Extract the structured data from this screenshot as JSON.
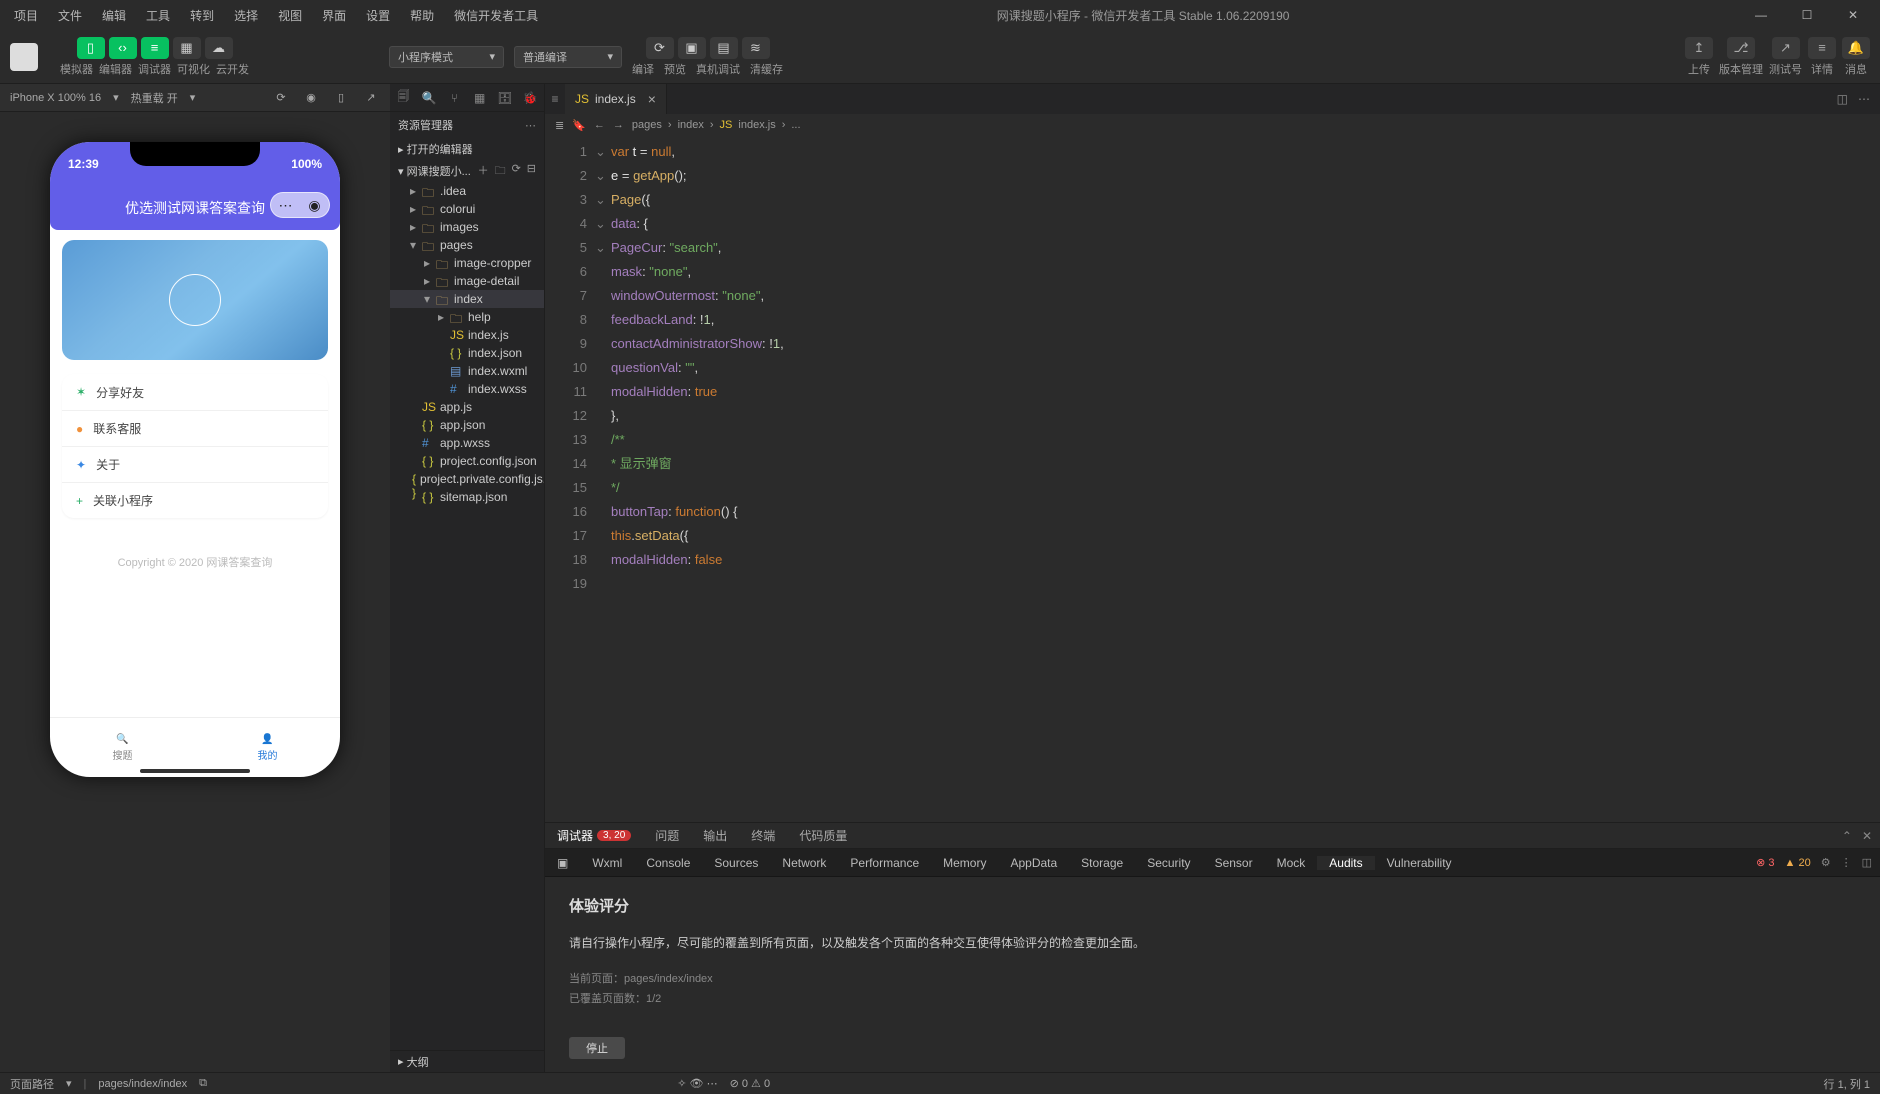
{
  "menubar": [
    "项目",
    "文件",
    "编辑",
    "工具",
    "转到",
    "选择",
    "视图",
    "界面",
    "设置",
    "帮助",
    "微信开发者工具"
  ],
  "window_title": "网课搜题小程序 - 微信开发者工具 Stable 1.06.2209190",
  "ribbon": {
    "groups": [
      {
        "btns": [
          "▭",
          "</>",
          "≡"
        ],
        "labels": "模拟器",
        "green": true
      },
      {
        "btns": [
          "≡"
        ],
        "labels": "编辑器",
        "green": true,
        "hidden": true
      }
    ],
    "g2": {
      "labels": [
        "模拟器",
        "编辑器",
        "调试器",
        "可视化",
        "云开发"
      ]
    },
    "mode": "小程序模式",
    "compile": "普通编译",
    "mid_labels": [
      "编译",
      "预览",
      "真机调试",
      "清缓存"
    ],
    "right_labels": [
      "上传",
      "版本管理",
      "测试号",
      "详情",
      "消息"
    ]
  },
  "sim": {
    "device": "iPhone X 100% 16",
    "hot": "热重载 开",
    "time": "12:39",
    "battery": "100%",
    "app_title": "优选测试网课答案查询",
    "menus": [
      {
        "icon": "✶",
        "color": "#2aae67",
        "label": "分享好友"
      },
      {
        "icon": "●",
        "color": "#f0913b",
        "label": "联系客服"
      },
      {
        "icon": "✦",
        "color": "#3a88e3",
        "label": "关于"
      },
      {
        "icon": "+",
        "color": "#2aae67",
        "label": "关联小程序"
      }
    ],
    "copyright": "Copyright © 2020 网课答案查询",
    "tabs": [
      {
        "icon": "🔍",
        "label": "搜题"
      },
      {
        "icon": "👤",
        "label": "我的"
      }
    ]
  },
  "explorer": {
    "title": "资源管理器",
    "open_editors": "打开的编辑器",
    "project": "网课搜题小...",
    "tree": [
      {
        "d": 1,
        "t": "folder",
        "n": ".idea",
        "c": false
      },
      {
        "d": 1,
        "t": "folder",
        "n": "colorui",
        "c": false
      },
      {
        "d": 1,
        "t": "folder",
        "n": "images",
        "c": false,
        "cls": "folder-img"
      },
      {
        "d": 1,
        "t": "folder",
        "n": "pages",
        "c": true,
        "cls": "folder-pg"
      },
      {
        "d": 2,
        "t": "folder",
        "n": "image-cropper",
        "c": false
      },
      {
        "d": 2,
        "t": "folder",
        "n": "image-detail",
        "c": false
      },
      {
        "d": 2,
        "t": "folder",
        "n": "index",
        "c": true,
        "sel": true
      },
      {
        "d": 3,
        "t": "folder",
        "n": "help",
        "c": false
      },
      {
        "d": 3,
        "t": "js",
        "n": "index.js"
      },
      {
        "d": 3,
        "t": "json",
        "n": "index.json"
      },
      {
        "d": 3,
        "t": "wxml",
        "n": "index.wxml"
      },
      {
        "d": 3,
        "t": "wxss",
        "n": "index.wxss"
      },
      {
        "d": 1,
        "t": "js",
        "n": "app.js"
      },
      {
        "d": 1,
        "t": "json",
        "n": "app.json"
      },
      {
        "d": 1,
        "t": "wxss",
        "n": "app.wxss"
      },
      {
        "d": 1,
        "t": "json",
        "n": "project.config.json"
      },
      {
        "d": 1,
        "t": "json",
        "n": "project.private.config.js..."
      },
      {
        "d": 1,
        "t": "json",
        "n": "sitemap.json"
      }
    ],
    "outline": "大纲"
  },
  "editor": {
    "tab": "index.js",
    "crumbs": [
      "pages",
      "index",
      "index.js",
      "..."
    ],
    "lines": [
      [
        [
          "kw",
          "var"
        ],
        [
          "id",
          " t "
        ],
        [
          "op",
          "="
        ],
        [
          "id",
          " "
        ],
        [
          "bool",
          "null"
        ],
        [
          "op",
          ","
        ]
      ],
      [
        [
          "id",
          "    e "
        ],
        [
          "op",
          "="
        ],
        [
          "id",
          " "
        ],
        [
          "fn",
          "getApp"
        ],
        [
          "op",
          "();"
        ]
      ],
      [
        [
          "fn",
          "Page"
        ],
        [
          "op",
          "({"
        ]
      ],
      [
        [
          "id",
          "  "
        ],
        [
          "prop",
          "data"
        ],
        [
          "op",
          ": {"
        ]
      ],
      [
        [
          "id",
          "    "
        ],
        [
          "prop",
          "PageCur"
        ],
        [
          "op",
          ": "
        ],
        [
          "strg",
          "\"search\""
        ],
        [
          "op",
          ","
        ]
      ],
      [
        [
          "id",
          "    "
        ],
        [
          "prop",
          "mask"
        ],
        [
          "op",
          ": "
        ],
        [
          "strg",
          "\"none\""
        ],
        [
          "op",
          ","
        ]
      ],
      [
        [
          "id",
          "    "
        ],
        [
          "prop",
          "windowOutermost"
        ],
        [
          "op",
          ": "
        ],
        [
          "strg",
          "\"none\""
        ],
        [
          "op",
          ","
        ]
      ],
      [
        [
          "id",
          "    "
        ],
        [
          "prop",
          "feedbackLand"
        ],
        [
          "op",
          ": !"
        ],
        [
          "num",
          "1"
        ],
        [
          "op",
          ","
        ]
      ],
      [
        [
          "id",
          "    "
        ],
        [
          "prop",
          "contactAdministratorShow"
        ],
        [
          "op",
          ": !"
        ],
        [
          "num",
          "1"
        ],
        [
          "op",
          ","
        ]
      ],
      [
        [
          "id",
          "    "
        ],
        [
          "prop",
          "questionVal"
        ],
        [
          "op",
          ": "
        ],
        [
          "strg",
          "\"\""
        ],
        [
          "op",
          ","
        ]
      ],
      [
        [
          "id",
          "    "
        ],
        [
          "prop",
          "modalHidden"
        ],
        [
          "op",
          ": "
        ],
        [
          "bool",
          "true"
        ]
      ],
      [
        [
          "op",
          "  },"
        ]
      ],
      [
        [
          "id",
          ""
        ]
      ],
      [
        [
          "cmt",
          "  /**"
        ]
      ],
      [
        [
          "cmt",
          "   * 显示弹窗"
        ]
      ],
      [
        [
          "cmt",
          "   */"
        ]
      ],
      [
        [
          "id",
          "  "
        ],
        [
          "prop",
          "buttonTap"
        ],
        [
          "op",
          ": "
        ],
        [
          "kw",
          "function"
        ],
        [
          "op",
          "() {"
        ]
      ],
      [
        [
          "id",
          "    "
        ],
        [
          "this",
          "this"
        ],
        [
          "op",
          "."
        ],
        [
          "fn",
          "setData"
        ],
        [
          "op",
          "({"
        ]
      ],
      [
        [
          "id",
          "      "
        ],
        [
          "prop",
          "modalHidden"
        ],
        [
          "op",
          ": "
        ],
        [
          "bool",
          "false"
        ]
      ]
    ]
  },
  "devtools": {
    "tabs": [
      "调试器",
      "问题",
      "输出",
      "终端",
      "代码质量"
    ],
    "badge": "3, 20",
    "subtabs": [
      "Wxml",
      "Console",
      "Sources",
      "Network",
      "Performance",
      "Memory",
      "AppData",
      "Storage",
      "Security",
      "Sensor",
      "Mock",
      "Audits",
      "Vulnerability"
    ],
    "active_sub": "Audits",
    "err": "3",
    "warn": "20",
    "audit": {
      "title": "体验评分",
      "desc": "请自行操作小程序，尽可能的覆盖到所有页面，以及触发各个页面的各种交互使得体验评分的检查更加全面。",
      "line1": "当前页面：pages/index/index",
      "line2": "已覆盖页面数：1/2",
      "stop": "停止"
    }
  },
  "footer": {
    "path_label": "页面路径",
    "path": "pages/index/index",
    "diag": "⊘ 0 ⚠ 0",
    "pos": "行 1, 列 1"
  }
}
